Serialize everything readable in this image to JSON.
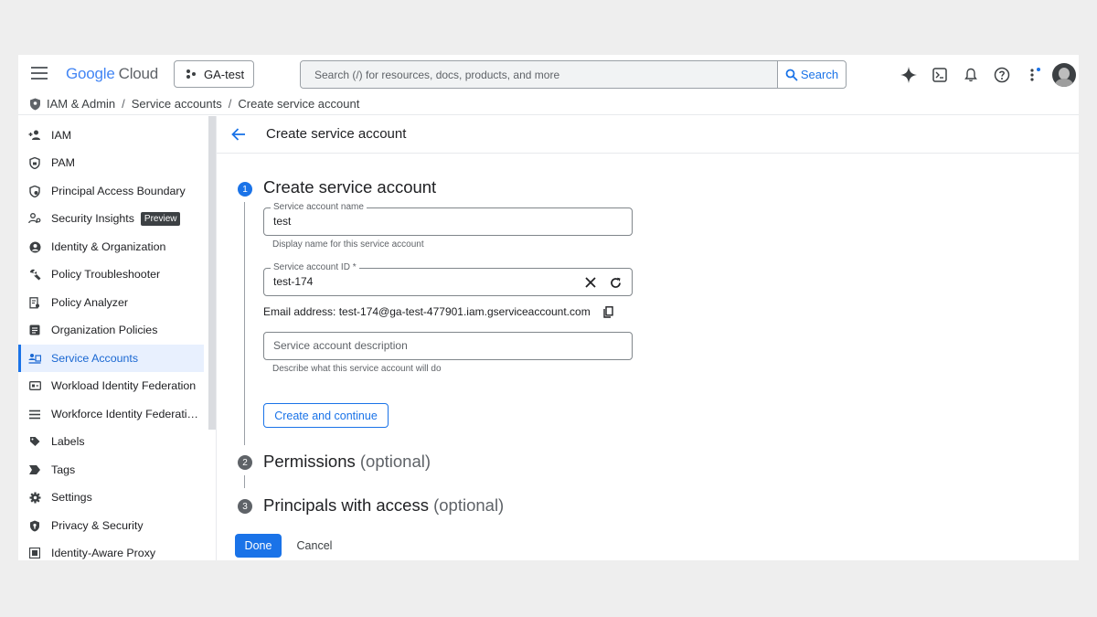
{
  "header": {
    "logo_google": "Google",
    "logo_cloud": "Cloud",
    "project": "GA-test",
    "search_placeholder": "Search (/) for resources, docs, products, and more",
    "search_button": "Search"
  },
  "breadcrumb": [
    "IAM & Admin",
    "Service accounts",
    "Create service account"
  ],
  "sidebar": {
    "items": [
      {
        "label": "IAM",
        "icon": "person-add-icon"
      },
      {
        "label": "PAM",
        "icon": "shield-lock-icon"
      },
      {
        "label": "Principal Access Boundary",
        "icon": "boundary-shield-icon"
      },
      {
        "label": "Security Insights",
        "icon": "insights-person-icon",
        "badge": "Preview"
      },
      {
        "label": "Identity & Organization",
        "icon": "account-circle-icon"
      },
      {
        "label": "Policy Troubleshooter",
        "icon": "wrench-icon"
      },
      {
        "label": "Policy Analyzer",
        "icon": "document-search-icon"
      },
      {
        "label": "Organization Policies",
        "icon": "list-box-icon"
      },
      {
        "label": "Service Accounts",
        "icon": "service-account-icon",
        "active": true
      },
      {
        "label": "Workload Identity Federation",
        "icon": "id-card-icon"
      },
      {
        "label": "Workforce Identity Federati…",
        "icon": "list-icon"
      },
      {
        "label": "Labels",
        "icon": "label-icon"
      },
      {
        "label": "Tags",
        "icon": "tag-chevron-icon"
      },
      {
        "label": "Settings",
        "icon": "gear-icon"
      },
      {
        "label": "Privacy & Security",
        "icon": "privacy-shield-icon"
      },
      {
        "label": "Identity-Aware Proxy",
        "icon": "proxy-grid-icon"
      }
    ]
  },
  "page": {
    "title": "Create service account",
    "step1": {
      "number": "1",
      "title": "Create service account"
    },
    "name_field": {
      "label": "Service account name",
      "value": "test",
      "hint": "Display name for this service account"
    },
    "id_field": {
      "label": "Service account ID *",
      "value": "test-174"
    },
    "email": "Email address: test-174@ga-test-477901.iam.gserviceaccount.com",
    "description_field": {
      "placeholder": "Service account description",
      "hint": "Describe what this service account will do"
    },
    "create_continue": "Create and continue",
    "step2": {
      "number": "2",
      "title": "Permissions",
      "optional": "(optional)"
    },
    "step3": {
      "number": "3",
      "title": "Principals with access",
      "optional": "(optional)"
    },
    "done": "Done",
    "cancel": "Cancel"
  },
  "colors": {
    "accent": "#1a73e8",
    "active_bg": "#e8f0fe",
    "step_inactive": "#5f6368"
  }
}
